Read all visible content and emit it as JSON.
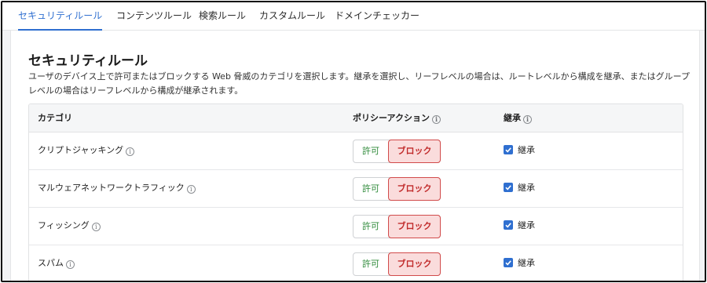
{
  "tabs": [
    {
      "label": "セキュリティルール",
      "active": true
    },
    {
      "label": "コンテンツルール",
      "active": false
    },
    {
      "label": "検索ルール",
      "active": false
    },
    {
      "label": "カスタムルール",
      "active": false
    },
    {
      "label": "ドメインチェッカー",
      "active": false
    }
  ],
  "page": {
    "title": "セキュリティルール",
    "description": "ユーザのデバイス上で許可またはブロックする Web 脅威のカテゴリを選択します。継承を選択し、リーフレベルの場合は、ルートレベルから構成を継承、またはグループレベルの場合はリーフレベルから構成が継承されます。"
  },
  "table": {
    "headers": {
      "category": "カテゴリ",
      "policy_action": "ポリシーアクション",
      "inherit": "継承"
    },
    "info_glyph": "i",
    "rows": [
      {
        "category": "クリプトジャッキング",
        "allow_label": "許可",
        "block_label": "ブロック",
        "selected": "block",
        "inherit_label": "継承",
        "inherit_checked": true
      },
      {
        "category": "マルウェアネットワークトラフィック",
        "allow_label": "許可",
        "block_label": "ブロック",
        "selected": "block",
        "inherit_label": "継承",
        "inherit_checked": true
      },
      {
        "category": "フィッシング",
        "allow_label": "許可",
        "block_label": "ブロック",
        "selected": "block",
        "inherit_label": "継承",
        "inherit_checked": true
      },
      {
        "category": "スパム",
        "allow_label": "許可",
        "block_label": "ブロック",
        "selected": "block",
        "inherit_label": "継承",
        "inherit_checked": true
      }
    ]
  },
  "colors": {
    "accent": "#2f6fd0",
    "allow": "#2f8a3a",
    "block_text": "#c12b2b",
    "block_bg": "#fadcdc"
  }
}
